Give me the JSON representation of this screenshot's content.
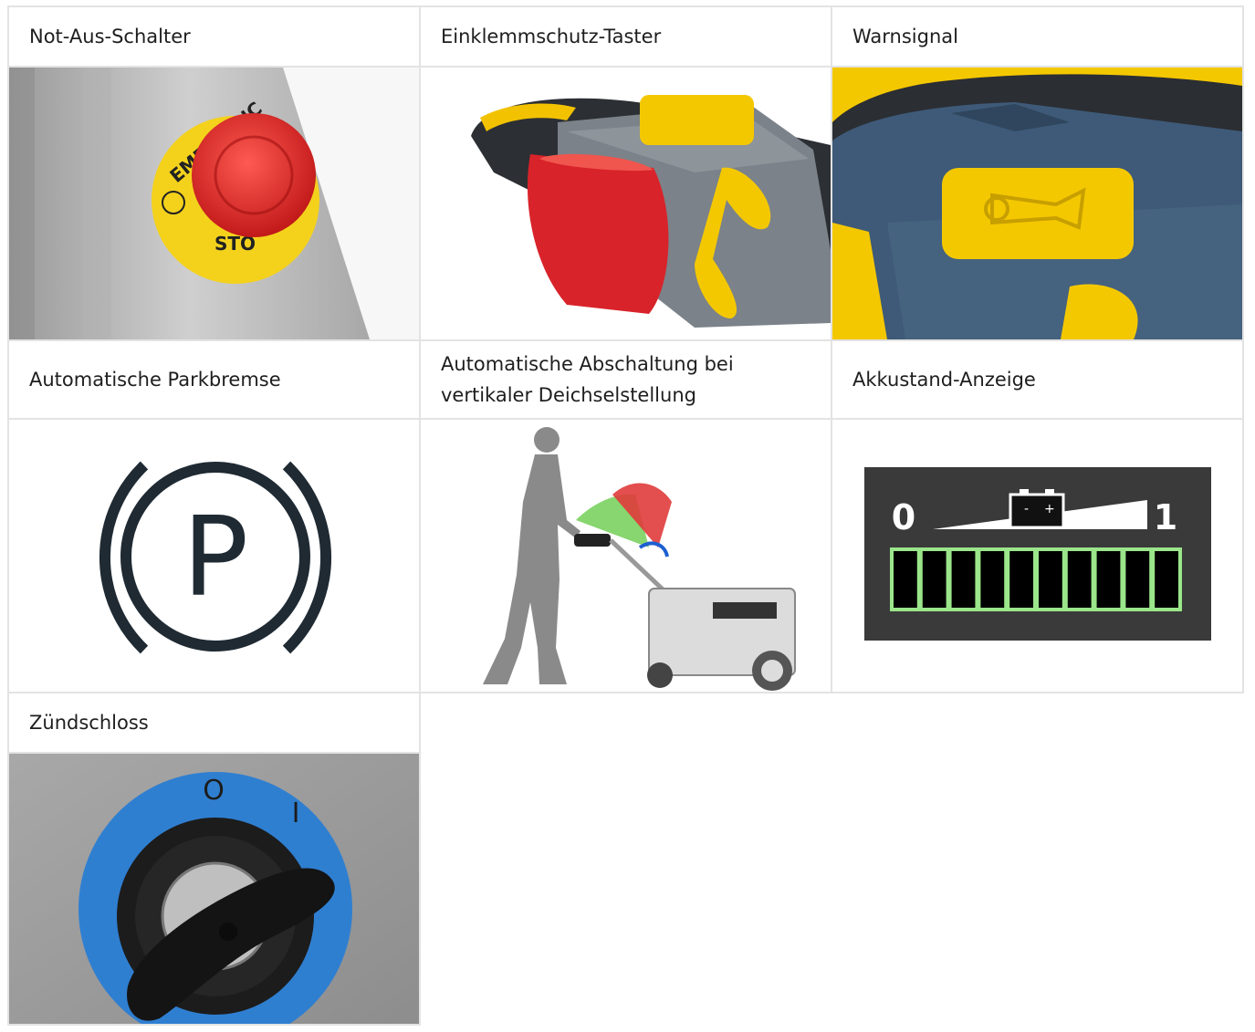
{
  "row1": {
    "not_aus": "Not-Aus-Schalter",
    "einklemm": "Einklemmschutz-Taster",
    "warn": "Warnsignal"
  },
  "row2": {
    "parkbremse": "Automatische Parkbremse",
    "abschaltung": "Automatische Abschaltung bei vertikaler Deichselstellung",
    "akku": "Akkustand-Anzeige"
  },
  "row3": {
    "zuend": "Zündschloss"
  },
  "emergency_text_top": "EMERGENC",
  "emergency_text_bottom": "STO",
  "battery": {
    "left": "0",
    "right": "1",
    "minus": "-",
    "plus": "+",
    "segments": 10
  },
  "parking_letter": "P",
  "switch_marks": {
    "off": "O",
    "on": "I"
  },
  "colors": {
    "border": "#e3e3e3",
    "accent_yellow": "#f6c90e",
    "accent_red": "#d8232a",
    "blue": "#2f7fd1",
    "battery_green": "#9be58a"
  }
}
